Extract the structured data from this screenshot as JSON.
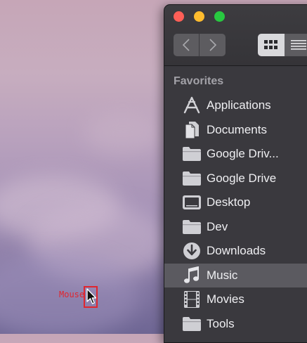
{
  "desktop": {
    "mouse_label": "Mouse"
  },
  "finder": {
    "sidebar": {
      "section_title": "Favorites",
      "items": [
        {
          "label": "Applications",
          "icon": "applications-icon",
          "selected": false
        },
        {
          "label": "Documents",
          "icon": "documents-icon",
          "selected": false
        },
        {
          "label": "Google Driv...",
          "icon": "folder-icon",
          "selected": false
        },
        {
          "label": "Google Drive",
          "icon": "folder-icon",
          "selected": false
        },
        {
          "label": "Desktop",
          "icon": "desktop-icon",
          "selected": false
        },
        {
          "label": "Dev",
          "icon": "folder-icon",
          "selected": false
        },
        {
          "label": "Downloads",
          "icon": "downloads-icon",
          "selected": false
        },
        {
          "label": "Music",
          "icon": "music-icon",
          "selected": true
        },
        {
          "label": "Movies",
          "icon": "movies-icon",
          "selected": false
        },
        {
          "label": "Tools",
          "icon": "folder-icon",
          "selected": false
        }
      ]
    }
  },
  "colors": {
    "selection": "#5b5a60",
    "close": "#fe5f57",
    "minimize": "#febc2e",
    "maximize": "#28c840",
    "annotation": "#e0262f"
  }
}
